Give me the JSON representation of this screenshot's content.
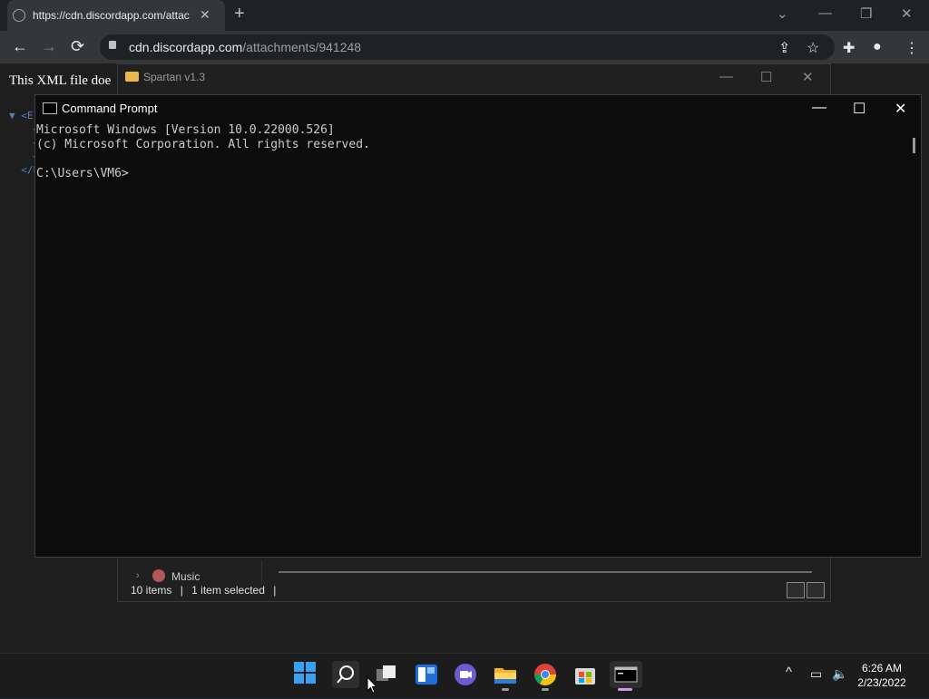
{
  "browser": {
    "tab_title": "https://cdn.discordapp.com/attac",
    "tab_close": "✕",
    "new_tab": "+",
    "url_host": "cdn.discordapp.com",
    "url_path": "/attachments/941248",
    "nav": {
      "back": "←",
      "forward": "→",
      "reload": "⟳"
    },
    "window_controls": {
      "dropdown": "⌄",
      "minimize": "—",
      "restore": "❐",
      "close": "✕"
    },
    "toolbar_icons": {
      "share": "⇪",
      "star": "☆",
      "extensions": "✚",
      "profile": "●",
      "menu": "⋮"
    }
  },
  "page": {
    "xml_note": "This XML file doe",
    "xml_tree": [
      "▼ <Er",
      "    <",
      "    <",
      "    <",
      "  </E"
    ]
  },
  "explorer": {
    "title": "Spartan v1.3",
    "controls": {
      "minimize": "—",
      "maximize": "☐",
      "close": "✕"
    },
    "nav_item": "Music",
    "chevron": "›",
    "status_items": "10 items",
    "status_selected": "1 item selected",
    "separator": "|"
  },
  "cmd": {
    "title": "Command Prompt",
    "controls": {
      "minimize": "—",
      "maximize": "☐",
      "close": "✕"
    },
    "output": "Microsoft Windows [Version 10.0.22000.526]\n(c) Microsoft Corporation. All rights reserved.\n\nC:\\Users\\VM6>"
  },
  "taskbar": {
    "apps": [
      "start",
      "search",
      "task-view",
      "widgets",
      "chat",
      "file-explorer",
      "chrome",
      "store",
      "terminal"
    ],
    "tray": {
      "overflow": "^",
      "network": "▭",
      "volume": "🔈"
    },
    "time": "6:26 AM",
    "date": "2/23/2022"
  },
  "colors": {
    "cmd_bg": "#0c0c0c",
    "cmd_text": "#cccccc",
    "chrome_toolbar": "#35363a",
    "taskbar": "#1c1c1c"
  }
}
